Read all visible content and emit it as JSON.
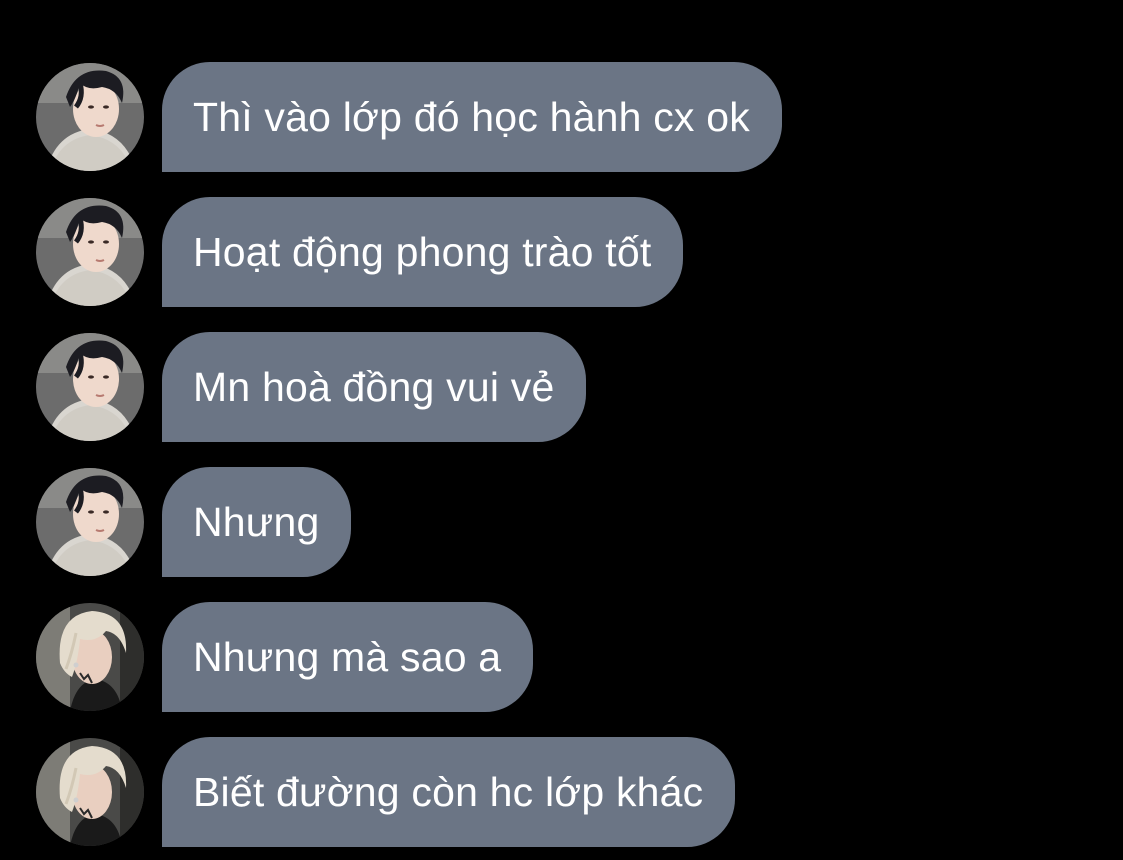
{
  "theme": {
    "background": "#000000",
    "bubble_color": "#6b7585",
    "text_color": "#ffffff"
  },
  "messages": [
    {
      "sender": "dark-haired-user",
      "avatar_icon": "dark-hair-avatar",
      "text": "Thì vào lớp đó học hành cx ok"
    },
    {
      "sender": "dark-haired-user",
      "avatar_icon": "dark-hair-avatar",
      "text": "Hoạt động phong trào tốt"
    },
    {
      "sender": "dark-haired-user",
      "avatar_icon": "dark-hair-avatar",
      "text": "Mn hoà đồng vui vẻ"
    },
    {
      "sender": "dark-haired-user",
      "avatar_icon": "dark-hair-avatar",
      "text": "Nhưng"
    },
    {
      "sender": "blonde-user",
      "avatar_icon": "blonde-hair-avatar",
      "text": "Nhưng mà sao a"
    },
    {
      "sender": "blonde-user",
      "avatar_icon": "blonde-hair-avatar",
      "text": "Biết đường còn hc lớp khác"
    }
  ]
}
